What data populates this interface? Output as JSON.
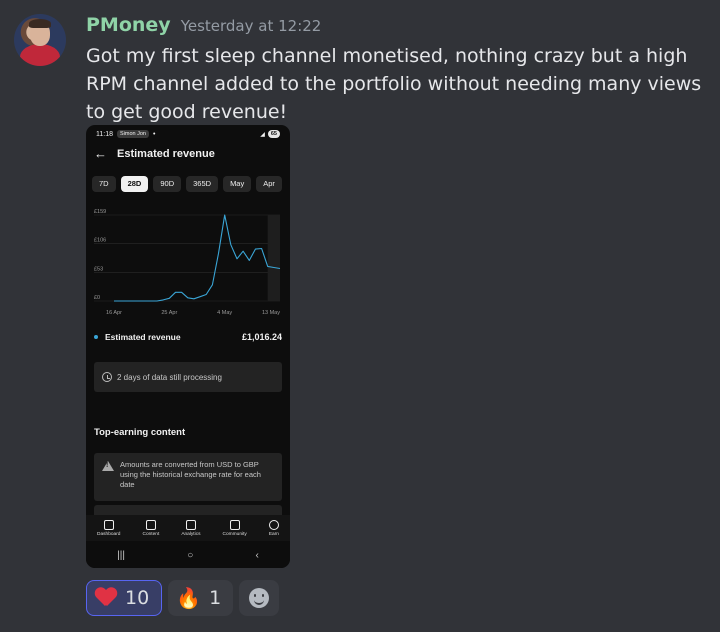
{
  "message": {
    "username": "PMoney",
    "timestamp": "Yesterday at 12:22",
    "text": "Got my first sleep channel monetised, nothing crazy but a high RPM channel added to the portfolio without needing many views to get good revenue!"
  },
  "phone": {
    "status_bar": {
      "time": "11:18",
      "notification": "Simon Jon",
      "battery": "65"
    },
    "title": "Estimated revenue",
    "chips": [
      {
        "label": "7D",
        "active": false
      },
      {
        "label": "28D",
        "active": true
      },
      {
        "label": "90D",
        "active": false
      },
      {
        "label": "365D",
        "active": false
      },
      {
        "label": "May",
        "active": false
      },
      {
        "label": "Apr",
        "active": false
      }
    ],
    "metric": {
      "label": "Estimated revenue",
      "value": "£1,016.24"
    },
    "processing_text": "2 days of data still processing",
    "section_title": "Top-earning content",
    "notice_text": "Amounts are converted from USD to GBP using the historical exchange rate for each date",
    "nav": [
      {
        "label": "Dashboard",
        "icon": "dashboard-icon"
      },
      {
        "label": "Content",
        "icon": "content-icon"
      },
      {
        "label": "Analytics",
        "icon": "analytics-icon"
      },
      {
        "label": "Community",
        "icon": "community-icon"
      },
      {
        "label": "Earn",
        "icon": "earn-icon"
      }
    ],
    "system_nav": {
      "recents": "|||",
      "home": "○",
      "back": "‹"
    }
  },
  "chart_data": {
    "type": "line",
    "title": "",
    "xlabel": "",
    "ylabel": "",
    "y_tick_labels": [
      "£159",
      "£106",
      "£53",
      "£0"
    ],
    "y_ticks": [
      159,
      106,
      53,
      0
    ],
    "x_tick_labels": [
      "16 Apr",
      "25 Apr",
      "4 May",
      "13 May"
    ],
    "ylim": [
      0,
      159
    ],
    "grid": true,
    "series": [
      {
        "values": [
          0,
          0,
          0,
          0,
          0,
          0,
          0,
          0,
          2,
          5,
          16,
          16,
          6,
          4,
          8,
          12,
          30,
          88,
          159,
          104,
          78,
          92,
          75,
          96,
          97,
          64,
          62,
          60
        ]
      }
    ],
    "color": "#3aa5d6"
  },
  "reactions": [
    {
      "emoji": "heart-icon",
      "count": "10",
      "me": true
    },
    {
      "emoji": "🔥",
      "count": "1",
      "me": false
    }
  ]
}
